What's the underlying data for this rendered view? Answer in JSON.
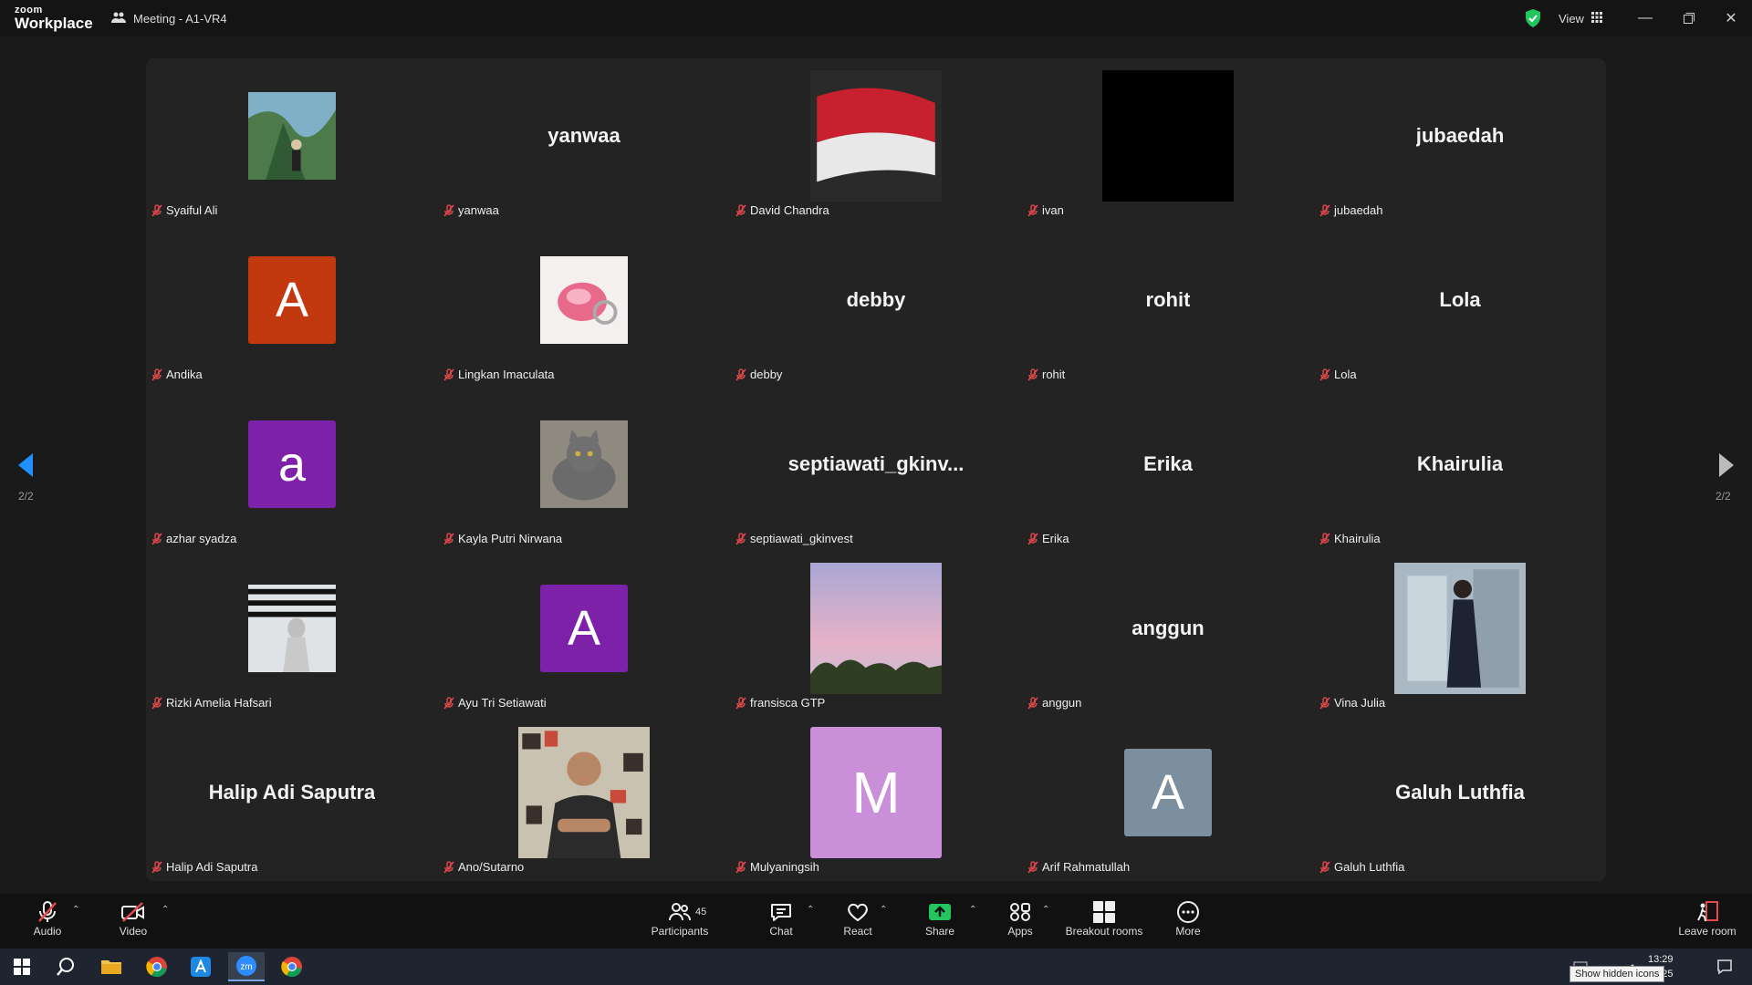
{
  "titlebar": {
    "brand_small": "zoom",
    "brand_big": "Workplace",
    "meeting_title": "Meeting - A1-VR4",
    "view_label": "View"
  },
  "colors": {
    "accent": "#0e72ed",
    "toolbar_bg": "#111111",
    "tile_bg": "#232323",
    "muted_red": "#e5484d",
    "share_green": "#22c55e"
  },
  "page_indicator": "2/2",
  "participants": [
    {
      "name": "Syaiful Ali",
      "display": "photo",
      "photo": "landscape-photo"
    },
    {
      "name": "yanwaa",
      "display": "name",
      "big": "yanwaa"
    },
    {
      "name": "David Chandra",
      "display": "photo",
      "photo": "flag-photo"
    },
    {
      "name": "ivan",
      "display": "photo",
      "photo": "black-photo"
    },
    {
      "name": "jubaedah",
      "display": "name",
      "big": "jubaedah"
    },
    {
      "name": "Andika",
      "display": "avatar",
      "letter": "A",
      "color": "#c2380f"
    },
    {
      "name": "Lingkan Imaculata",
      "display": "photo",
      "photo": "ring-photo"
    },
    {
      "name": "debby",
      "display": "name",
      "big": "debby"
    },
    {
      "name": "rohit",
      "display": "name",
      "big": "rohit"
    },
    {
      "name": "Lola",
      "display": "name",
      "big": "Lola"
    },
    {
      "name": "azhar syadza",
      "display": "avatar",
      "letter": "a",
      "color": "#7d22a8"
    },
    {
      "name": "Kayla Putri Nirwana",
      "display": "photo",
      "photo": "cat-photo"
    },
    {
      "name": "septiawati_gkinvest",
      "display": "name",
      "big": "septiawati_gkinv..."
    },
    {
      "name": "Erika",
      "display": "name",
      "big": "Erika"
    },
    {
      "name": "Khairulia",
      "display": "name",
      "big": "Khairulia"
    },
    {
      "name": "Rizki Amelia Hafsari",
      "display": "photo",
      "photo": "window-photo"
    },
    {
      "name": "Ayu Tri Setiawati",
      "display": "avatar",
      "letter": "A",
      "color": "#7d22a8"
    },
    {
      "name": "fransisca GTP",
      "display": "photo",
      "photo": "sky-photo"
    },
    {
      "name": "anggun",
      "display": "name",
      "big": "anggun"
    },
    {
      "name": "Vina Julia",
      "display": "photo",
      "photo": "mirror-photo"
    },
    {
      "name": "Halip Adi Saputra",
      "display": "name",
      "big": "Halip Adi Saputra"
    },
    {
      "name": "Ano/Sutarno",
      "display": "photo",
      "photo": "person-photo"
    },
    {
      "name": "Mulyaningsih",
      "display": "avatar",
      "letter": "M",
      "color": "#c98fd8"
    },
    {
      "name": "Arif Rahmatullah",
      "display": "avatar",
      "letter": "A",
      "color": "#7b8f9e"
    },
    {
      "name": "Galuh Luthfia",
      "display": "name",
      "big": "Galuh Luthfia"
    }
  ],
  "toolbar": {
    "audio": "Audio",
    "video": "Video",
    "participants": "Participants",
    "participants_count": "45",
    "chat": "Chat",
    "react": "React",
    "share": "Share",
    "apps": "Apps",
    "breakout": "Breakout rooms",
    "more": "More",
    "leave": "Leave room"
  },
  "taskbar": {
    "time": "13:29",
    "date": "/2025",
    "tooltip": "Show hidden icons"
  }
}
